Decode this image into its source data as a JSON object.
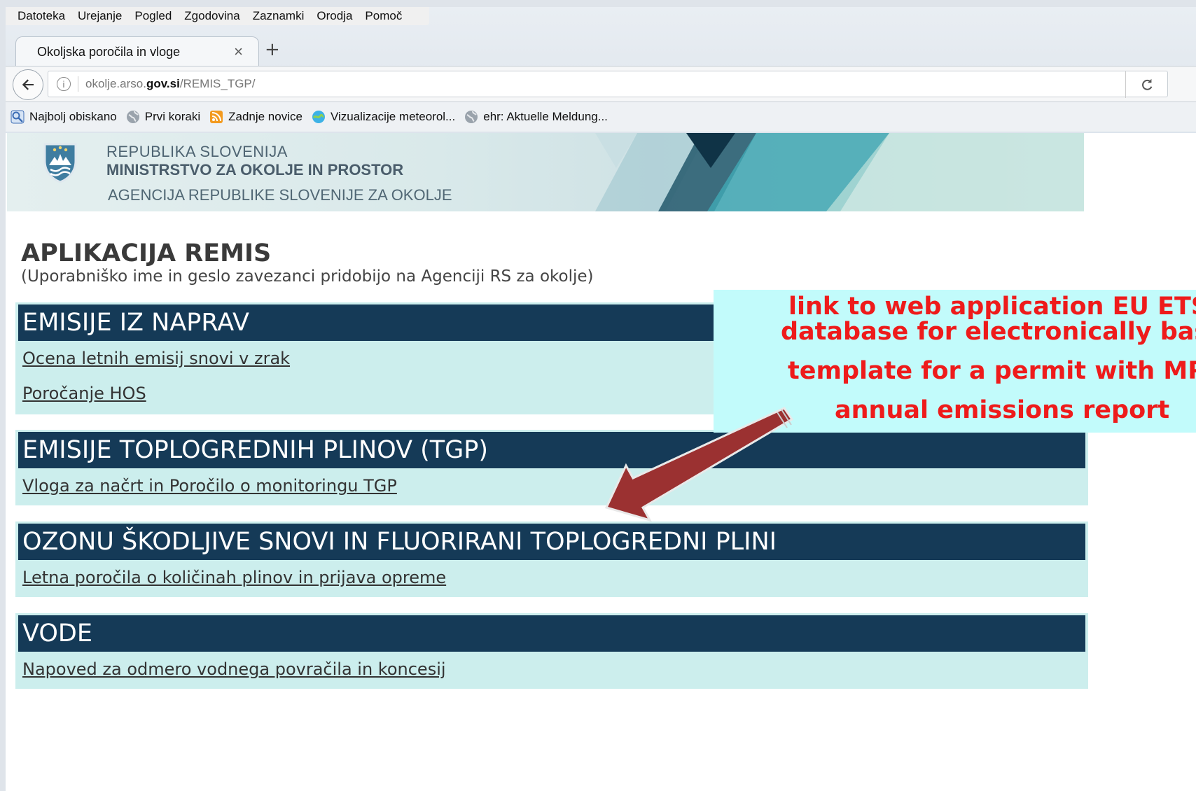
{
  "browser": {
    "menu": [
      "Datoteka",
      "Urejanje",
      "Pogled",
      "Zgodovina",
      "Zaznamki",
      "Orodja",
      "Pomoč"
    ],
    "tab_title": "Okoljska poročila in vloge",
    "tab_close": "×",
    "new_tab": "+",
    "url_prefix": "okolje.arso.",
    "url_domain": "gov.si",
    "url_path": "/REMIS_TGP/",
    "bookmarks": [
      {
        "label": "Najbolj obiskano",
        "icon": "most-visited-icon"
      },
      {
        "label": "Prvi koraki",
        "icon": "globe-icon"
      },
      {
        "label": "Zadnje novice",
        "icon": "rss-icon"
      },
      {
        "label": "Vizualizacije meteorol...",
        "icon": "weather-icon"
      },
      {
        "label": "ehr: Aktuelle Meldung...",
        "icon": "globe-icon"
      }
    ]
  },
  "header": {
    "line1": "REPUBLIKA SLOVENIJA",
    "line2": "MINISTRSTVO ZA OKOLJE IN PROSTOR",
    "line3": "AGENCIJA REPUBLIKE SLOVENIJE ZA OKOLJE"
  },
  "page": {
    "title": "APLIKACIJA REMIS",
    "subtitle": "(Uporabniško ime in geslo zavezanci pridobijo na Agenciji RS za okolje)"
  },
  "sections": [
    {
      "title": "EMISIJE IZ NAPRAV",
      "links": [
        "Ocena letnih emisij snovi v zrak",
        "Poročanje HOS"
      ]
    },
    {
      "title": "EMISIJE TOPLOGREDNIH PLINOV (TGP)",
      "links": [
        "Vloga za načrt in Poročilo o monitoringu TGP"
      ]
    },
    {
      "title": "OZONU ŠKODLJIVE SNOVI IN FLUORIRANI TOPLOGREDNI PLINI",
      "links": [
        "Letna poročila o količinah plinov in prijava opreme"
      ]
    },
    {
      "title": "VODE",
      "links": [
        "Napoved za odmero vodnega povračila in koncesij"
      ]
    }
  ],
  "callout": {
    "line1": "link to web application EU ETS",
    "line2": "database for electronically base",
    "line3": "template for a permit with MP /",
    "line4": "annual emissions report"
  },
  "colors": {
    "section_header": "#153a57",
    "section_body": "#cceeed",
    "callout_bg": "#c2fbfb",
    "callout_text": "#ee1b1b",
    "arrow": "#9b3131"
  }
}
